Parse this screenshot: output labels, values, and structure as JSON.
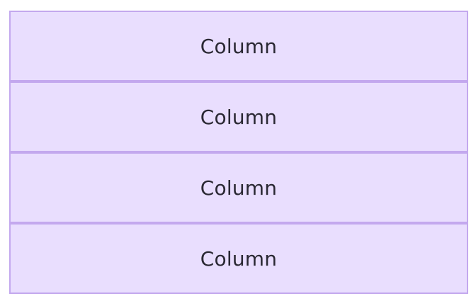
{
  "colors": {
    "fill": "#e9defe",
    "border": "#c3a8ee",
    "text": "#2a2833"
  },
  "blocks": [
    {
      "label": "Column"
    },
    {
      "label": "Column"
    },
    {
      "label": "Column"
    },
    {
      "label": "Column"
    }
  ]
}
